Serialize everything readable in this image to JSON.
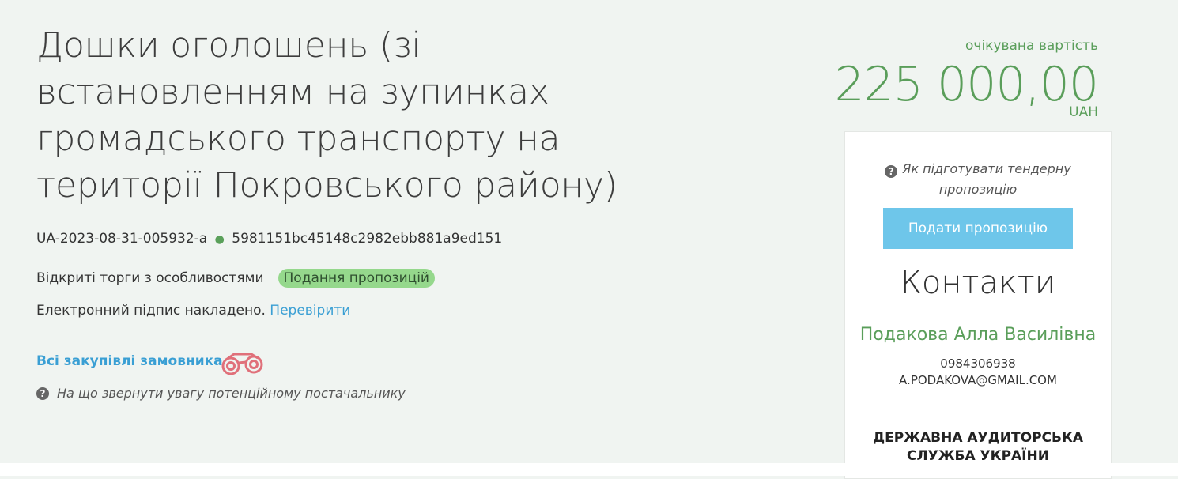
{
  "tender": {
    "title": "Дошки оголошень (зі встановленням на зупинках громадського транспорту на території Покровського району)",
    "id": "UA-2023-08-31-005932-a",
    "hash": "5981151bc45148c2982ebb881a9ed151",
    "procedure_type": "Відкриті торги з особливостями",
    "status": "Подання пропозицій",
    "signature_text": "Електронний підпис накладено.",
    "signature_link": "Перевірити",
    "all_purchases_link": "Всі закупівлі замовника",
    "supplier_hint": "На що звернути увагу потенційному постачальнику"
  },
  "cost": {
    "label": "очікувана вартість",
    "value": "225 000,00",
    "currency": "UAH"
  },
  "panel": {
    "howto": "Як підготувати тендерну пропозицію",
    "submit_label": "Подати пропозицію",
    "contacts_heading": "Контакти",
    "contact_name": "Подакова Алла Василівна",
    "contact_phone": "0984306938",
    "contact_email": "A.PODAKOVA@GMAIL.COM",
    "organization": "ДЕРЖАВНА АУДИТОРСЬКА СЛУЖБА УКРАЇНИ"
  },
  "icons": {
    "question": "question-circle-icon",
    "binoculars": "binoculars-icon"
  },
  "colors": {
    "accent_green": "#5a9e5a",
    "link_blue": "#3a9fd4",
    "button_blue": "#6ec6ea",
    "badge_green": "#95d88c",
    "binoculars_red": "#e0707a"
  }
}
